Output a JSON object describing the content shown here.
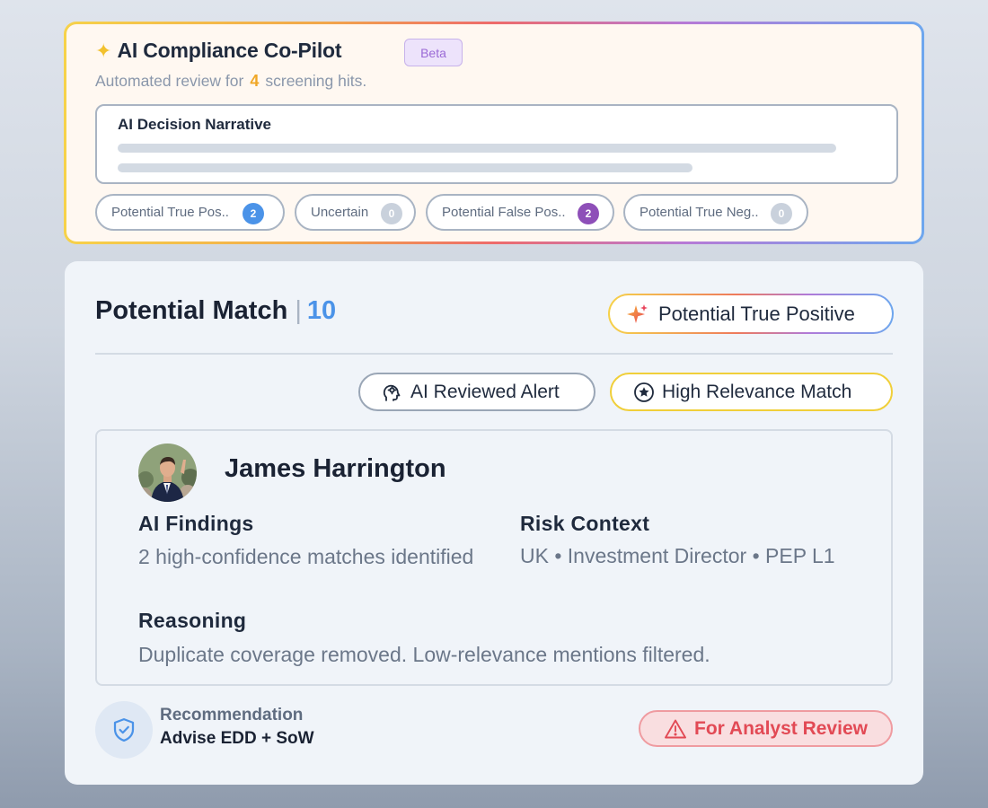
{
  "copilot": {
    "title": "AI Compliance Co-Pilot",
    "beta_label": "Beta",
    "subtitle_prefix": "Automated review for",
    "hit_count": "4",
    "subtitle_suffix": "screening hits.",
    "narrative_title": "AI Decision Narrative",
    "chips": [
      {
        "label": "Potential True Pos..",
        "count": "2",
        "color": "#4b93e8"
      },
      {
        "label": "Uncertain",
        "count": "0",
        "color": "#c9d1dc"
      },
      {
        "label": "Potential False Pos..",
        "count": "2",
        "color": "#8e4fb8"
      },
      {
        "label": "Potential True Neg..",
        "count": "0",
        "color": "#c9d1dc"
      }
    ]
  },
  "match": {
    "title": "Potential Match",
    "separator": "|",
    "number": "10",
    "verdict": "Potential True Positive",
    "tags": {
      "ai_reviewed": "AI Reviewed Alert",
      "high_relevance": "High Relevance Match"
    },
    "person": {
      "name": "James Harrington",
      "findings_label": "AI Findings",
      "findings_text": "2 high-confidence matches identified",
      "risk_label": "Risk Context",
      "risk_text": "UK • Investment Director • PEP L1",
      "reasoning_label": "Reasoning",
      "reasoning_text": "Duplicate coverage removed. Low-relevance mentions filtered."
    },
    "recommendation": {
      "label": "Recommendation",
      "value": "Advise EDD + SoW"
    },
    "status": "For Analyst Review"
  },
  "icons": {
    "title_icon": "sparkle-icon",
    "verdict_icon": "sparkle-icon",
    "ai_reviewed_icon": "ai-brain-icon",
    "high_relevance_icon": "star-circle-icon",
    "recommendation_icon": "shield-check-icon",
    "status_icon": "warning-triangle-icon"
  },
  "colors": {
    "accent_blue": "#4b93e8",
    "hit_orange": "#f0a726",
    "warning_red": "#e24a55",
    "beta_purple": "#9b6ad6"
  }
}
